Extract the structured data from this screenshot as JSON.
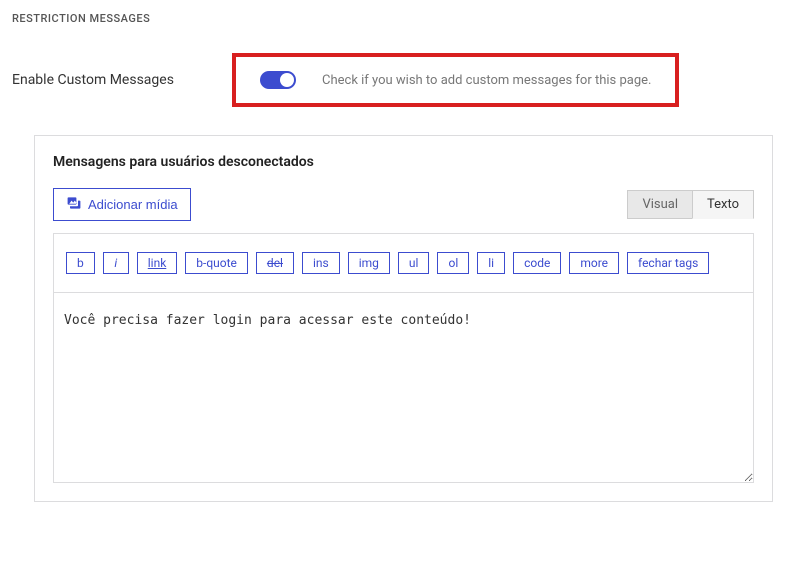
{
  "section_title": "RESTRICTION MESSAGES",
  "enable": {
    "label": "Enable Custom Messages",
    "description": "Check if you wish to add custom messages for this page.",
    "checked": true
  },
  "editor": {
    "title": "Mensagens para usuários desconectados",
    "media_button": "Adicionar mídia",
    "tabs": {
      "visual": "Visual",
      "text": "Texto"
    },
    "toolbar": {
      "b": "b",
      "i": "i",
      "link": "link",
      "bquote": "b-quote",
      "del": "del",
      "ins": "ins",
      "img": "img",
      "ul": "ul",
      "ol": "ol",
      "li": "li",
      "code": "code",
      "more": "more",
      "close": "fechar tags"
    },
    "content": "Você precisa fazer login para acessar este conteúdo!"
  }
}
